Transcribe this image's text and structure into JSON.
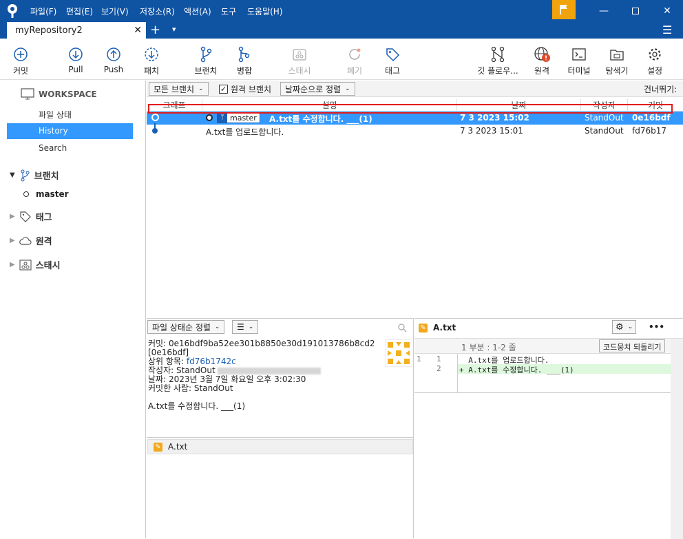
{
  "menu": [
    "파일(F)",
    "편집(E)",
    "보기(V)",
    "저장소(R)",
    "액션(A)",
    "도구",
    "도움말(H)"
  ],
  "tab": {
    "title": "myRepository2",
    "close": "✕",
    "add": "+",
    "dropdown": "▾"
  },
  "toolbar": {
    "commit": "커밋",
    "pull": "Pull",
    "push": "Push",
    "fetch": "패치",
    "branch": "브랜치",
    "merge": "병합",
    "stash": "스태시",
    "discard": "폐기",
    "tag": "태그",
    "gitflow": "깃 플로우...",
    "remote": "원격",
    "terminal": "터미널",
    "explorer": "탐색기",
    "settings": "설정"
  },
  "sidebar": {
    "workspace": "WORKSPACE",
    "file_status": "파일 상태",
    "history": "History",
    "search": "Search",
    "branches": "브랜치",
    "master": "master",
    "tags": "태그",
    "remotes": "원격",
    "stash": "스태시"
  },
  "filter": {
    "all_branches": "모든 브랜치",
    "remote_branches": "원격 브랜치",
    "remote_checked": true,
    "sort": "날짜순으로 정렬",
    "skip": "건너뛰기:"
  },
  "columns": {
    "graph": "그래프",
    "desc": "설명",
    "date": "날짜",
    "author": "작성자",
    "commit": "커밋"
  },
  "commits": [
    {
      "branch": "master",
      "message": "A.txt를 수정합니다. ___(1)",
      "date": "7 3 2023 15:02",
      "author": "StandOut",
      "hash": "0e16bdf"
    },
    {
      "branch": "",
      "message": "A.txt를 업로드합니다.",
      "date": "7 3 2023 15:01",
      "author": "StandOut",
      "hash": "fd76b17"
    }
  ],
  "lower_left": {
    "sort_label": "파일 상태순 정렬",
    "list_icon": "☰",
    "commit_label": "커밋:",
    "commit_full": "0e16bdf9ba52ee301b8850e30d191013786b8cd2",
    "commit_short": "[0e16bdf]",
    "parent_label": "상위 항목:",
    "parent": "fd76b1742c",
    "author_label": "작성자:",
    "author": "StandOut",
    "date_label": "날짜:",
    "date": "2023년 3월 7일 화요일 오후 3:02:30",
    "committer_label": "커밋한 사람:",
    "committer": "StandOut",
    "message": "A.txt를 수정합니다. ___(1)",
    "file": "A.txt"
  },
  "lower_right": {
    "file": "A.txt",
    "hunk": "1 부분 : 1-2 줄",
    "revert": "코드뭉치 되돌리기",
    "more": "•••",
    "lines": [
      {
        "old": "1",
        "new": "1",
        "text": "  A.txt를 업로드합니다."
      },
      {
        "old": "",
        "new": "2",
        "text": "+ A.txt를 수정합니다. ___(1)"
      }
    ]
  },
  "colors": {
    "title": "#0f53a3",
    "select": "#3399ff",
    "flag": "#f0a30a",
    "highlight": "#e21b1b"
  }
}
